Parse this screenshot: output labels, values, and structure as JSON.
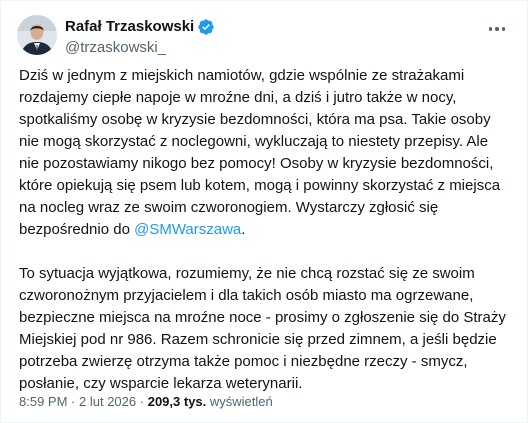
{
  "author": {
    "name": "Rafał Trzaskowski",
    "handle": "@trzaskowski_"
  },
  "icons": {
    "verified": "verified-badge-icon",
    "more": "more-options-icon"
  },
  "colors": {
    "link": "#1d9bf0",
    "text": "#0f1419",
    "secondary": "#536471"
  },
  "tweet": {
    "paragraph1": [
      "Dziś w jednym z miejskich namiotów, gdzie wspólnie ze strażakami",
      "rozdajemy ciepłe napoje w mroźne dni, a dziś i jutro także w nocy,",
      "spotkaliśmy osobę w kryzysie bezdomności, która ma psa. Takie osoby",
      "nie mogą skorzystać z noclegowni, wykluczają to niestety przepisy. Ale",
      "nie pozostawiamy nikogo bez pomocy! Osoby w kryzysie bezdomności,",
      "które opiekują się psem lub kotem, mogą i powinny skorzystać z miejsca",
      "na nocleg wraz ze swoim czworonogiem. Wystarczy zgłosić się"
    ],
    "paragraph1_last_prefix": "bezpośrednio do ",
    "mention": "@SMWarszawa",
    "paragraph1_last_suffix": ".",
    "paragraph2": [
      "To sytuacja wyjątkowa, rozumiemy, że nie chcą rozstać się ze swoim",
      "czworonożnym przyjacielem i dla takich osób miasto ma ogrzewane,",
      "bezpieczne miejsca na mroźne noce - prosimy o zgłoszenie się do Straży",
      "Miejskiej pod nr 986. Razem schronicie się przed zimnem, a jeśli będzie",
      "potrzeba zwierzę otrzyma także pomoc i niezbędne rzeczy - smycz,",
      "posłanie, czy wsparcie lekarza weterynarii."
    ]
  },
  "meta": {
    "time": "8:59 PM",
    "separator": "·",
    "date": "2 lut 2026",
    "views_count": "209,3 tys.",
    "views_label": "wyświetleń"
  }
}
